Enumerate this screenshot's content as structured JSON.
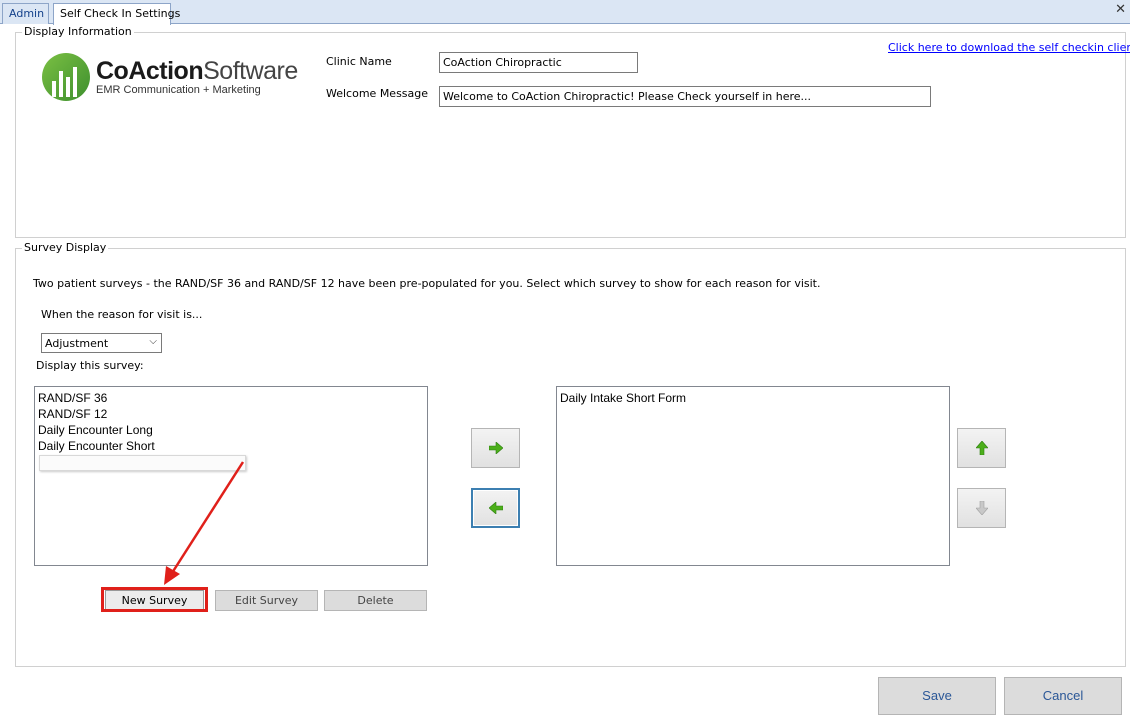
{
  "tabs": [
    {
      "label": "Admin",
      "active": false
    },
    {
      "label": "Self Check In Settings",
      "active": true
    }
  ],
  "display_information": {
    "group_title": "Display Information",
    "logo": {
      "brand_bold": "CoAction",
      "brand_regular": "Software",
      "tagline": "EMR Communication + Marketing"
    },
    "clinic_name_label": "Clinic Name",
    "clinic_name_value": "CoAction  Chiropractic",
    "welcome_label": "Welcome Message",
    "welcome_value": "Welcome to CoAction Chiropractic! Please Check yourself in here...",
    "download_link": "Click here to download the self checkin client"
  },
  "survey_display": {
    "group_title": "Survey Display",
    "description": "Two patient surveys - the RAND/SF 36 and RAND/SF 12 have been pre-populated for you. Select which survey to show for each reason for visit.",
    "reason_label": "When the reason for visit is...",
    "reason_selected": "Adjustment",
    "display_label": "Display this survey:",
    "available_surveys": [
      "RAND/SF 36",
      "RAND/SF 12",
      "Daily Encounter Long",
      "Daily Encounter Short"
    ],
    "selected_surveys": [
      "Daily Intake Short Form"
    ],
    "buttons": {
      "new_survey": "New Survey",
      "edit_survey": "Edit Survey",
      "delete": "Delete"
    }
  },
  "footer": {
    "save": "Save",
    "cancel": "Cancel"
  },
  "colors": {
    "tab_bg": "#dbe6f4",
    "link": "#0000ff",
    "annotation_red": "#e0201a",
    "arrow_green": "#4caf1a",
    "footer_text": "#2b5797"
  },
  "icons": {
    "move_right": "arrow-right-icon",
    "move_left": "arrow-left-icon",
    "move_up": "arrow-up-icon",
    "move_down": "arrow-down-icon",
    "close": "close-icon"
  }
}
